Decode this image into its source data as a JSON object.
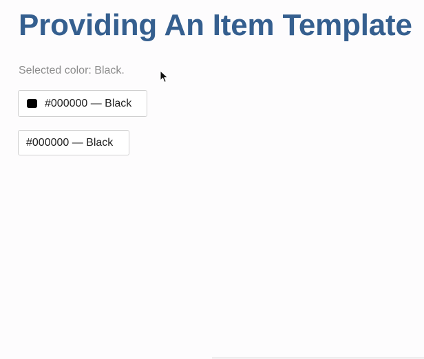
{
  "page": {
    "title": "Providing An Item Template",
    "selected_text": "Selected color: Black."
  },
  "picker": {
    "label": "#000000 — Black",
    "swatch_color": "#000000",
    "swatch_icon": "color-swatch-icon"
  },
  "plain_option": {
    "label": "#000000 — Black"
  },
  "colors": {
    "title": "#355f8f",
    "muted_text": "#8c8c8c",
    "border": "#cfcfcf",
    "background": "#fdfcfd"
  },
  "cursor": {
    "icon": "mouse-pointer-icon"
  }
}
